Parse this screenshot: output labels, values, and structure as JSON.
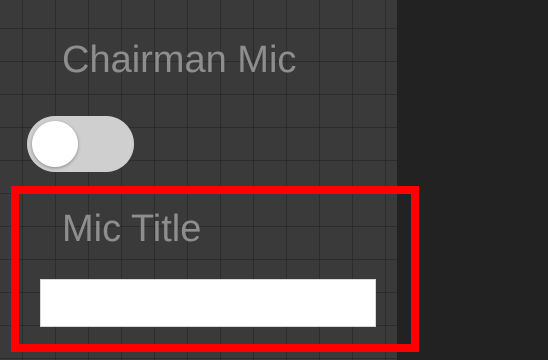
{
  "chairman_mic": {
    "label": "Chairman Mic",
    "toggle_on": false
  },
  "mic_title": {
    "label": "Mic Title",
    "value": "",
    "placeholder": ""
  },
  "colors": {
    "panel_background": "#3a3a3a",
    "page_background": "#222222",
    "label_text": "#8e8e8e",
    "toggle_track": "#cfcfcf",
    "toggle_knob": "#ffffff",
    "highlight": "#ff0000",
    "input_background": "#ffffff"
  }
}
